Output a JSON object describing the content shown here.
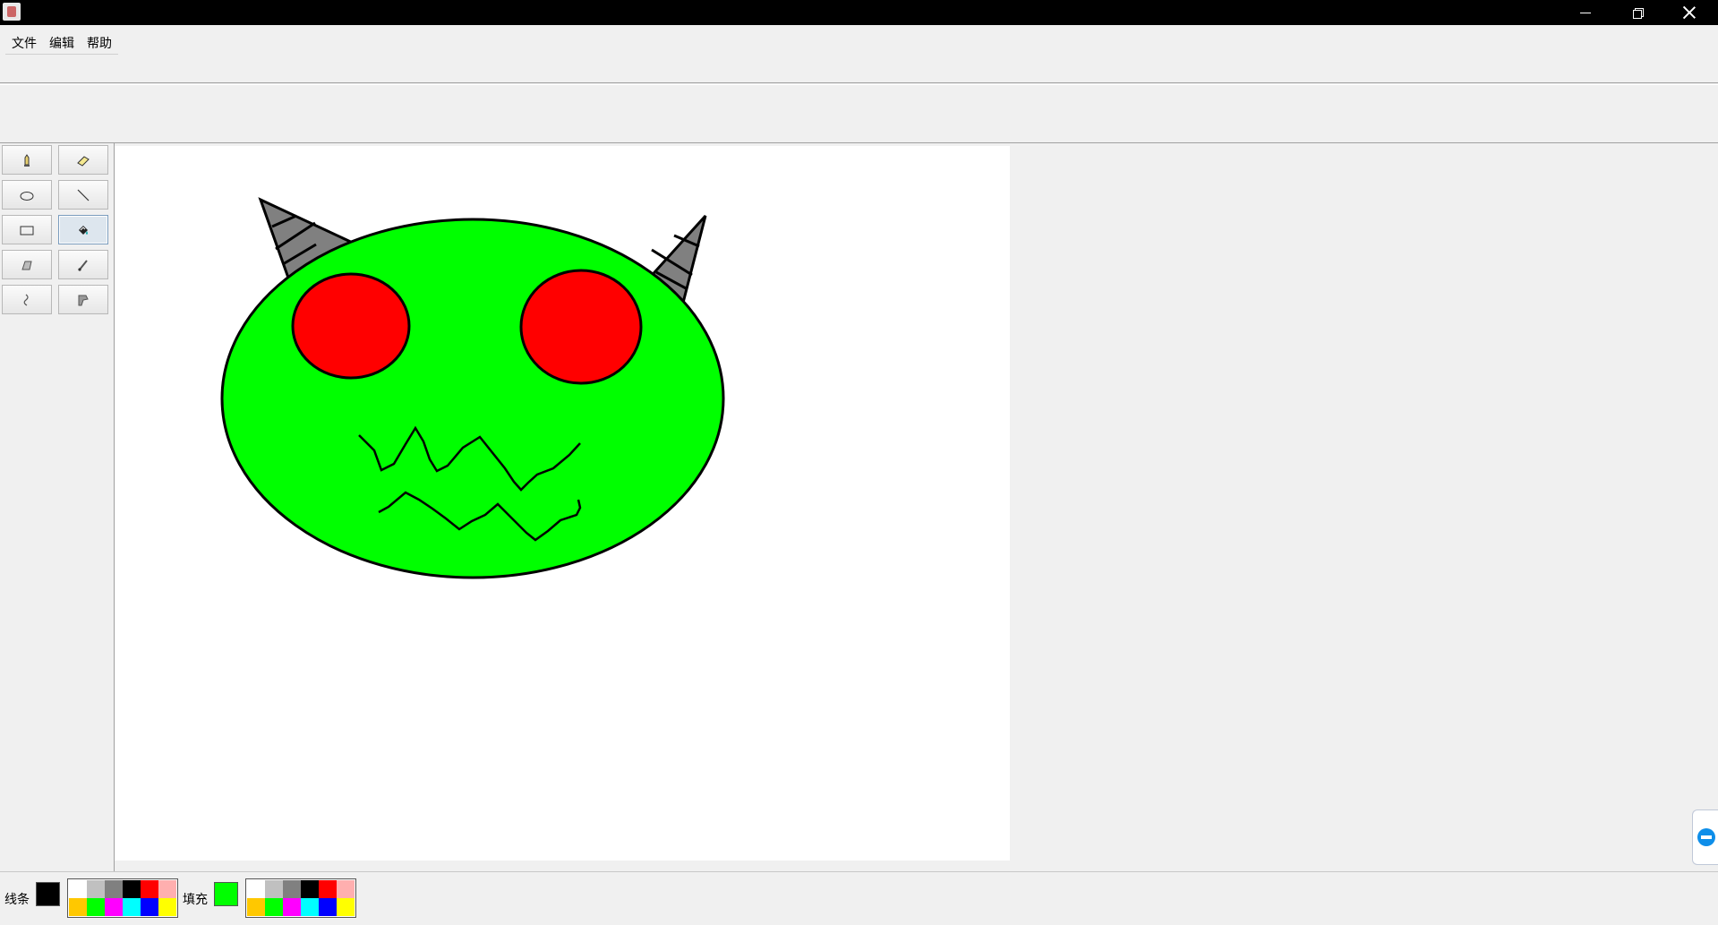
{
  "window": {
    "icon": "java-cup-icon",
    "controls": [
      "minimize-icon",
      "restore-icon",
      "close-icon"
    ]
  },
  "menu": {
    "items": [
      {
        "label": "文件"
      },
      {
        "label": "编辑"
      },
      {
        "label": "帮助"
      }
    ]
  },
  "tools": [
    {
      "icon": "pencil-icon",
      "selected": false
    },
    {
      "icon": "eraser-icon",
      "selected": false
    },
    {
      "icon": "ellipse-icon",
      "selected": false
    },
    {
      "icon": "line-icon",
      "selected": false
    },
    {
      "icon": "rectangle-icon",
      "selected": false
    },
    {
      "icon": "paint-bucket-icon",
      "selected": true
    },
    {
      "icon": "polygon-icon",
      "selected": false
    },
    {
      "icon": "brush-icon",
      "selected": false
    },
    {
      "icon": "curve-icon",
      "selected": false
    },
    {
      "icon": "color-picker-icon",
      "selected": false
    }
  ],
  "bottom": {
    "stroke_label": "线条",
    "fill_label": "填充",
    "stroke_color": "#000000",
    "fill_color": "#00ff00",
    "palette": [
      "#ffffff",
      "#c0c0c0",
      "#808080",
      "#000000",
      "#ff0000",
      "#ffafaf",
      "#ffc800",
      "#00ff00",
      "#ff00ff",
      "#00ffff",
      "#0000ff",
      "#ffff00"
    ]
  },
  "drawing": {
    "face_color": "#00ff00",
    "eye_color": "#ff0000",
    "horn_color": "#808080",
    "outline_color": "#000000"
  },
  "side_tab": {
    "icon": "teamviewer-icon"
  }
}
